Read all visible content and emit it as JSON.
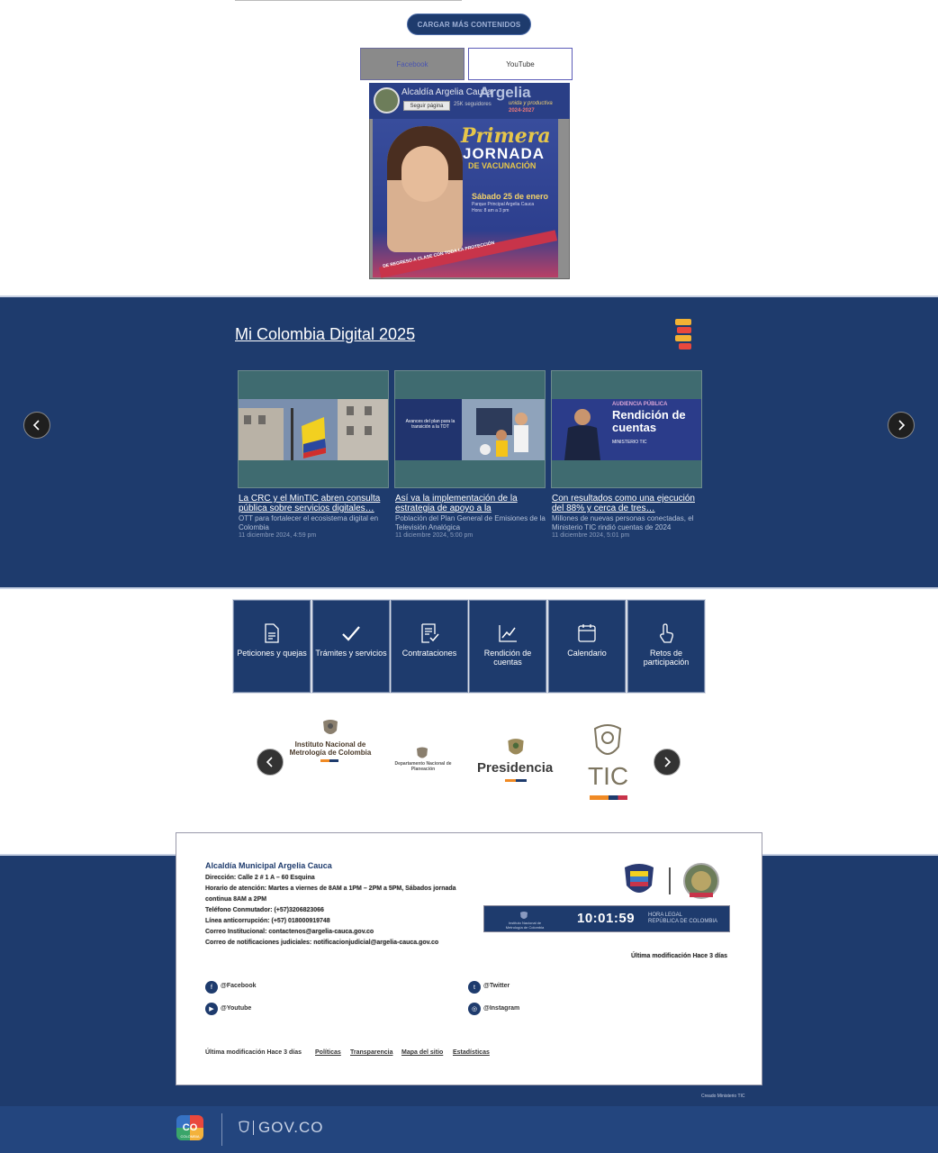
{
  "top": {
    "load_more": "CARGAR MÁS CONTENIDOS",
    "tabs": [
      "Facebook",
      "YouTube"
    ],
    "fb_page_name": "Alcaldía Argelia Cauca",
    "fb_follow": "Seguir página",
    "fb_followers": "25K seguidores",
    "fb_brand": "Argelia",
    "fb_brand_sub": "unida y productiva",
    "fb_brand_years": "2024-2027",
    "poster": {
      "line1": "Primera",
      "line2": "JORNADA",
      "line3": "DE VACUNACIÓN",
      "date": "Sábado 25 de enero",
      "place": "Parque Principal Argelia Cauca Hora: 8 am a 3 pm",
      "band": "DE REGRESO A CLASE CON TODA LA PROTECCIÓN"
    }
  },
  "digital": {
    "title": "Mi Colombia Digital 2025",
    "cards": [
      {
        "title": "La CRC y el MinTIC abren consulta pública sobre servicios digitales…",
        "desc": "OTT para fortalecer el ecosistema digital en Colombia",
        "date": "11 diciembre 2024, 4:59 pm"
      },
      {
        "title": "Así va la implementación de la estrategia de apoyo a la",
        "desc": "Población del Plan General de Emisiones de la Televisión Analógica",
        "date": "11 diciembre 2024, 5:00 pm",
        "img_text": "Avances del plan para la transición a la TDT"
      },
      {
        "title": "Con resultados como una ejecución del 88% y cerca de tres…",
        "desc": "Millones de nuevas personas conectadas, el Ministerio TIC rindió cuentas de 2024",
        "date": "11 diciembre 2024, 5:01 pm",
        "img_text_1": "AUDIENCIA PÚBLICA",
        "img_text_2": "Rendición de cuentas",
        "img_text_3": "MINISTERIO TIC"
      }
    ]
  },
  "quick_links": [
    {
      "label": "Peticiones y quejas",
      "icon": "document-icon"
    },
    {
      "label": "Trámites y servicios",
      "icon": "check-icon"
    },
    {
      "label": "Contrataciones",
      "icon": "contract-icon"
    },
    {
      "label": "Rendición de cuentas",
      "icon": "chart-line-icon"
    },
    {
      "label": "Calendario",
      "icon": "calendar-icon"
    },
    {
      "label": "Retos de participación",
      "icon": "hand-pointer-icon"
    }
  ],
  "partners": {
    "inm": "Instituto Nacional de Metrología de Colombia",
    "rtvc": "Departamento Nacional de Planeación",
    "presidencia": "Presidencia",
    "tic": "TIC"
  },
  "footer": {
    "entity": "Alcaldía Municipal Argelia Cauca",
    "address": "Dirección: Calle 2 # 1 A – 60 Esquina",
    "hours_1": "Horario de atención: Martes a viernes de 8AM a 1PM – 2PM a 5PM, Sábados jornada",
    "hours_2": "continua 8AM a 2PM",
    "phone": "Teléfono Conmutador: (+57)3206823066",
    "anticorruption": "Línea anticorrupción: (+57) 018000919748",
    "email": "Correo Institucional: contactenos@argelia-cauca.gov.co",
    "email_judicial": "Correo de notificaciones judiciales: notificacionjudicial@argelia-cauca.gov.co",
    "clock_time": "10:01:59",
    "clock_label_1": "HORA LEGAL",
    "clock_label_2": "REPÚBLICA DE COLOMBIA",
    "clock_inm": "Instituto Nacional de Metrología de Colombia",
    "last_modified": "Última modificación Hace 3 días",
    "social": {
      "facebook": "@Facebook",
      "twitter": "@Twitter",
      "youtube": "@Youtube",
      "instagram": "@Instagram"
    },
    "links": [
      "Políticas",
      "Transparencia",
      "Mapa del sitio",
      "Estadísticas"
    ],
    "credit": "Creado Ministerio TIC",
    "co_logo": "CO",
    "co_sub": "COLOMBIA",
    "gov": "GOV.CO"
  }
}
